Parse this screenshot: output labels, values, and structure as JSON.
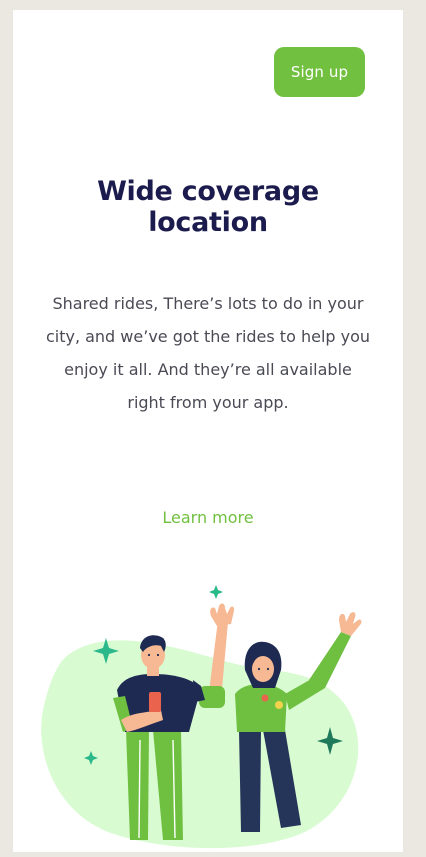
{
  "header": {
    "signup_label": "Sign up"
  },
  "hero": {
    "title_line1": "Wide coverage",
    "title_line2": "location",
    "description": "Shared rides, There’s lots to do in your city, and we’ve got the rides to help you enjoy it all. And they’re all available right from your app.",
    "learn_more": "Learn more"
  },
  "colors": {
    "accent": "#72c040",
    "title": "#1c1b4d",
    "background": "#ebe8e2",
    "blob": "#d9fbd2",
    "sparkle": "#2bb88a"
  }
}
